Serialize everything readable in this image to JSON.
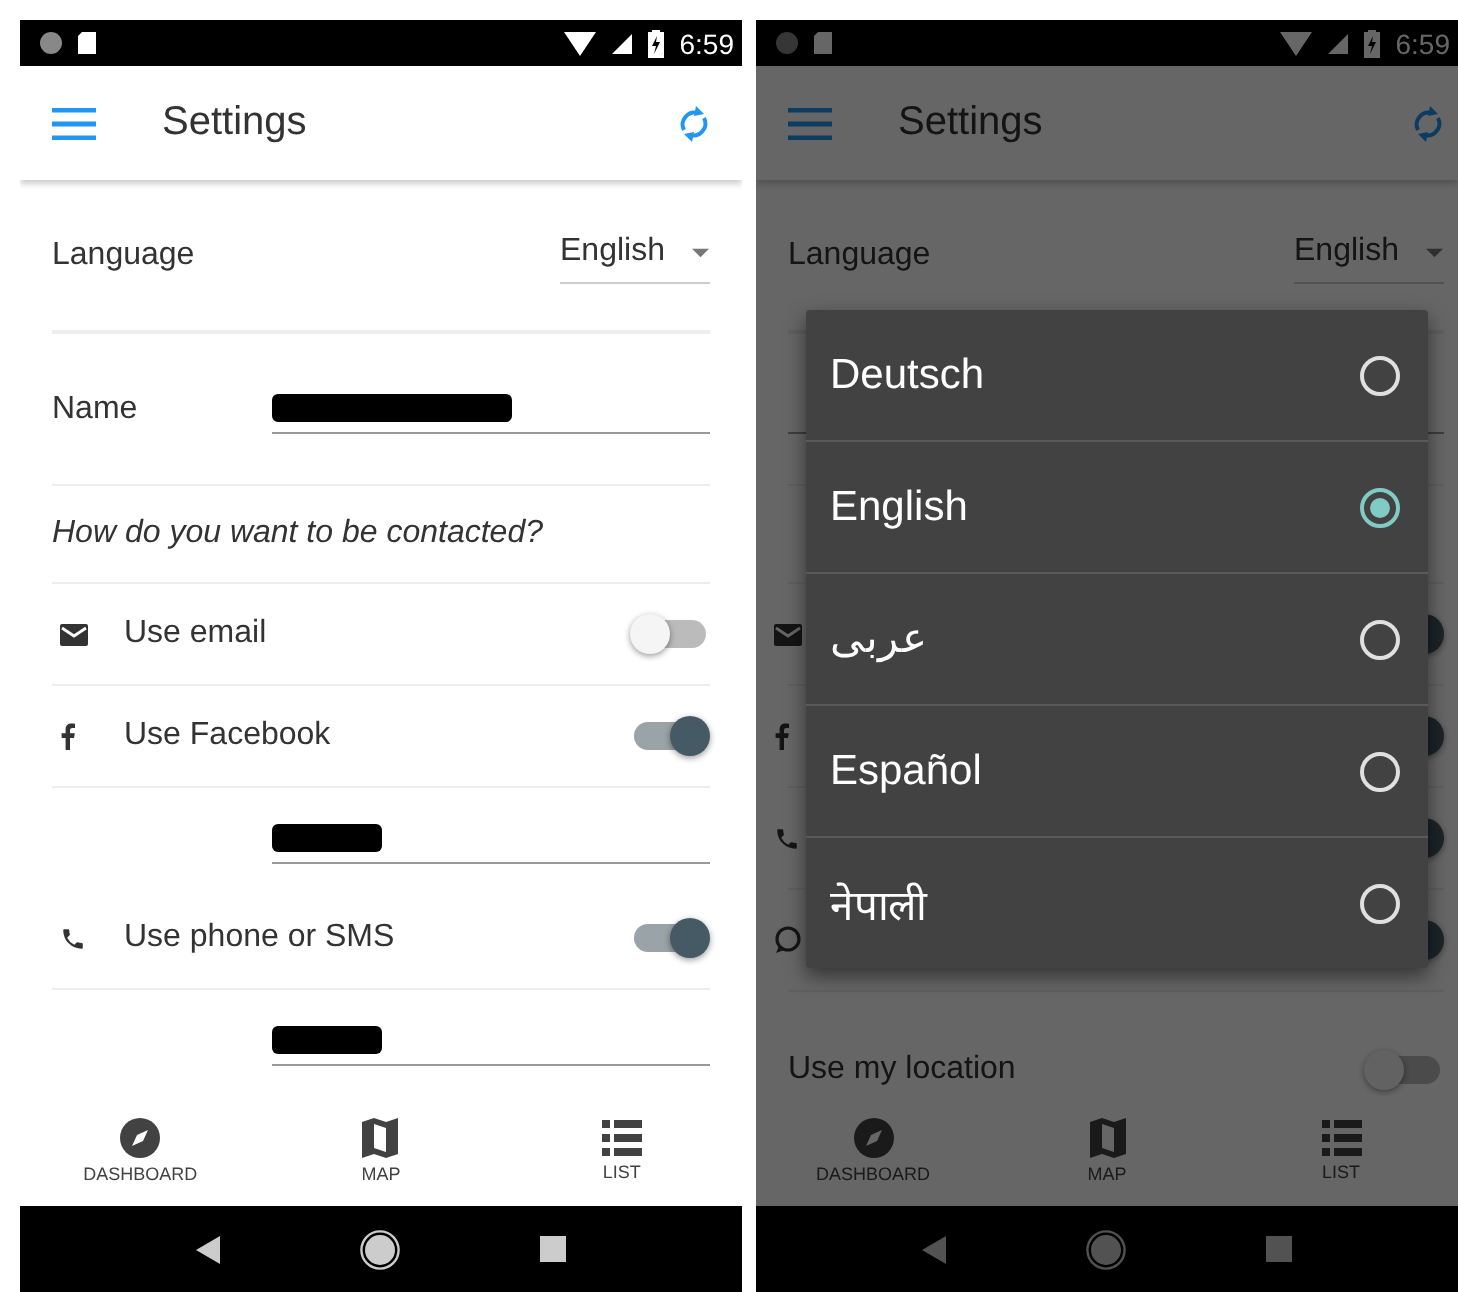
{
  "screens": [
    {
      "status_bar": {
        "time": "6:59"
      },
      "app_bar": {
        "title": "Settings"
      },
      "settings": [
        {
          "kind": "select",
          "label": "Language",
          "value": "English"
        },
        {
          "kind": "field",
          "label": "Name",
          "redacted": true
        },
        {
          "kind": "heading",
          "label": "How do you want to be contacted?"
        },
        {
          "kind": "email_switch",
          "label": "Use email",
          "on": false
        },
        {
          "kind": "facebook_switch",
          "label": "Use Facebook",
          "on": true
        },
        {
          "kind": "field",
          "redacted": true
        },
        {
          "kind": "phone_switch",
          "label": "Use phone or SMS",
          "on": true
        },
        {
          "kind": "field",
          "redacted": true
        }
      ],
      "bottom_nav": [
        {
          "label": "DASHBOARD"
        },
        {
          "label": "MAP"
        },
        {
          "label": "LIST"
        }
      ]
    },
    {
      "status_bar": {
        "time": "6:59"
      },
      "app_bar": {
        "title": "Settings"
      },
      "dimmed": true,
      "settings": [
        {
          "kind": "select",
          "label": "Language",
          "value": "English"
        },
        {
          "kind": "field"
        },
        {
          "kind": "heading"
        },
        {
          "kind": "email_switch",
          "on": true
        },
        {
          "kind": "facebook_switch",
          "on": true
        },
        {
          "kind": "phone_switch",
          "on": true
        },
        {
          "kind": "chat_switch",
          "on": true
        },
        {
          "kind": "switch",
          "label": "Use my location",
          "on": false
        }
      ],
      "dialog": {
        "options": [
          {
            "label": "Deutsch",
            "selected": false
          },
          {
            "label": "English",
            "selected": true
          },
          {
            "label": "عربى",
            "selected": false
          },
          {
            "label": "Español",
            "selected": false
          },
          {
            "label": "नेपाली",
            "selected": false
          }
        ]
      },
      "bottom_nav": [
        {
          "label": "DASHBOARD"
        },
        {
          "label": "MAP"
        },
        {
          "label": "LIST"
        }
      ]
    }
  ]
}
